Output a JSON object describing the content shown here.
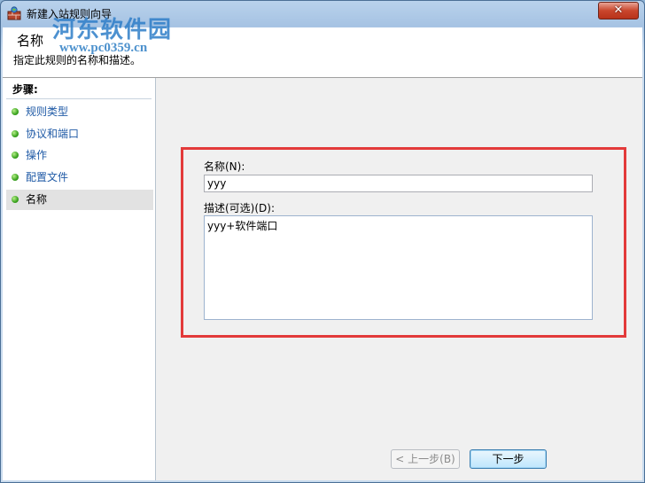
{
  "window": {
    "title": "新建入站规则向导",
    "close_label": "✕"
  },
  "watermark": {
    "text": "河东软件园",
    "url": "www.pc0359.cn"
  },
  "header": {
    "title": "名称",
    "description": "指定此规则的名称和描述。"
  },
  "sidebar": {
    "title": "步骤:",
    "items": [
      {
        "label": "规则类型"
      },
      {
        "label": "协议和端口"
      },
      {
        "label": "操作"
      },
      {
        "label": "配置文件"
      },
      {
        "label": "名称"
      }
    ]
  },
  "form": {
    "name_label": "名称(N):",
    "name_value": "yyy",
    "desc_label": "描述(可选)(D):",
    "desc_value": "yyy+软件端口"
  },
  "buttons": {
    "back_label": "< 上一步(B)",
    "next_label": "下一步"
  },
  "colors": {
    "highlight": "#e33a3a",
    "step_bullet": "#3aa31f"
  }
}
